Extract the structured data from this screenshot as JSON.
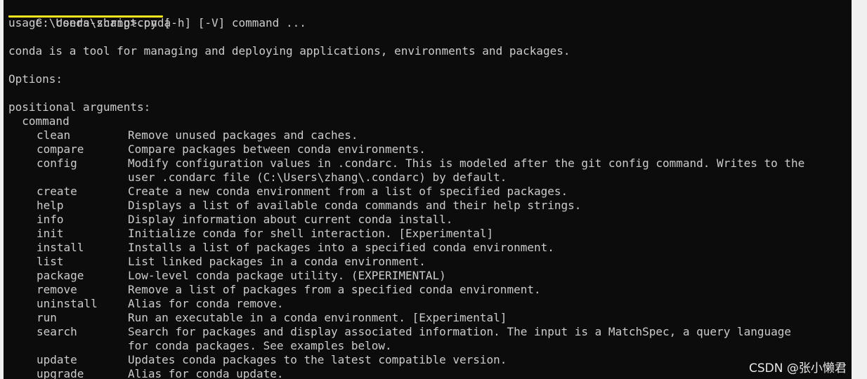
{
  "colors": {
    "console_bg": "#0c0c0c",
    "text": "#cccccc",
    "highlight": "#f5e61e"
  },
  "prompt": {
    "text": "C:\\Users\\zhang>conda"
  },
  "usage": "usage: conda-script.py [-h] [-V] command ...",
  "description": "conda is a tool for managing and deploying applications, environments and packages.",
  "options_label": "Options:",
  "positional_label": "positional arguments:",
  "command_label": "  command",
  "commands": [
    {
      "name": "clean",
      "desc": "Remove unused packages and caches."
    },
    {
      "name": "compare",
      "desc": "Compare packages between conda environments."
    },
    {
      "name": "config",
      "desc": "Modify configuration values in .condarc. This is modeled after the git config command. Writes to the",
      "desc2": "user .condarc file (C:\\Users\\zhang\\.condarc) by default."
    },
    {
      "name": "create",
      "desc": "Create a new conda environment from a list of specified packages."
    },
    {
      "name": "help",
      "desc": "Displays a list of available conda commands and their help strings."
    },
    {
      "name": "info",
      "desc": "Display information about current conda install."
    },
    {
      "name": "init",
      "desc": "Initialize conda for shell interaction. [Experimental]"
    },
    {
      "name": "install",
      "desc": "Installs a list of packages into a specified conda environment."
    },
    {
      "name": "list",
      "desc": "List linked packages in a conda environment."
    },
    {
      "name": "package",
      "desc": "Low-level conda package utility. (EXPERIMENTAL)"
    },
    {
      "name": "remove",
      "desc": "Remove a list of packages from a specified conda environment."
    },
    {
      "name": "uninstall",
      "desc": "Alias for conda remove."
    },
    {
      "name": "run",
      "desc": "Run an executable in a conda environment. [Experimental]"
    },
    {
      "name": "search",
      "desc": "Search for packages and display associated information. The input is a MatchSpec, a query language",
      "desc2": "for conda packages. See examples below."
    },
    {
      "name": "update",
      "desc": "Updates conda packages to the latest compatible version."
    },
    {
      "name": "upgrade",
      "desc": "Alias for conda update."
    }
  ],
  "watermark": "CSDN @张小懒君"
}
